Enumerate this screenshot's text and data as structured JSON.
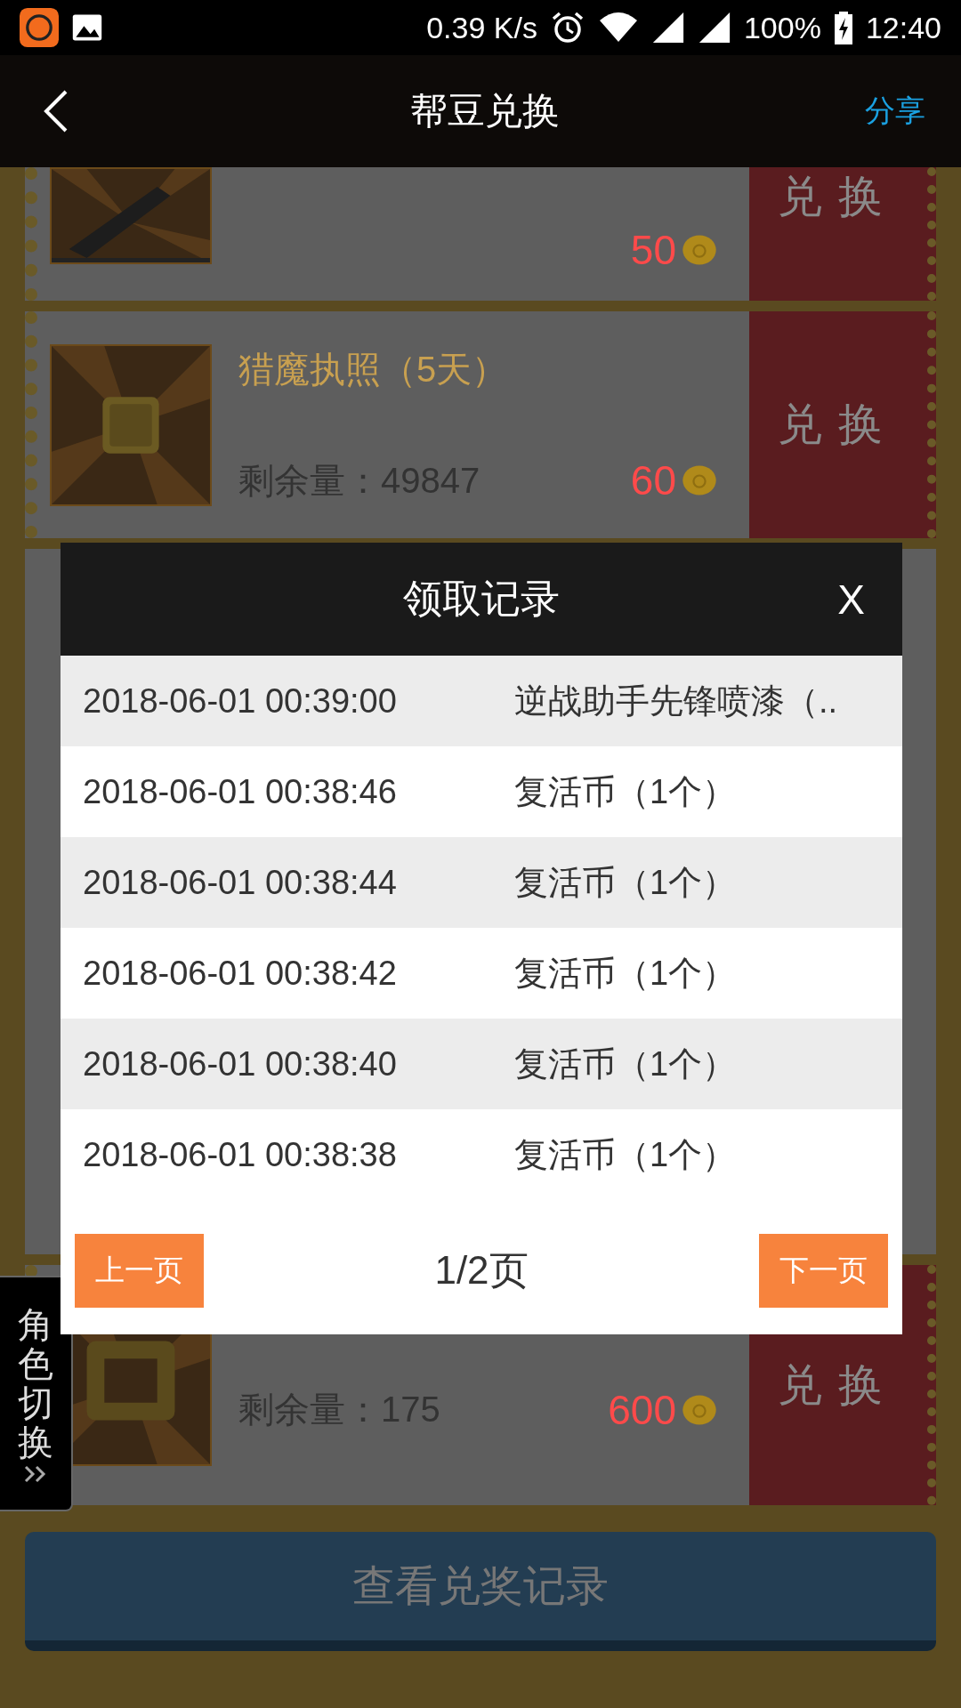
{
  "status_bar": {
    "net_speed": "0.39 K/s",
    "battery": "100%",
    "time": "12:40"
  },
  "header": {
    "title": "帮豆兑换",
    "action": "分享"
  },
  "items": [
    {
      "price": "50",
      "button": "兑换"
    },
    {
      "name": "猎魔执照（5天）",
      "stock": "剩余量：49847",
      "price": "60",
      "button": "兑换"
    },
    {
      "stock": "剩余量：175",
      "price": "600",
      "button": "兑换"
    }
  ],
  "side_tab": {
    "label": "角色切换"
  },
  "records_button": "查看兑奖记录",
  "dialog": {
    "title": "领取记录",
    "close": "X",
    "rows": [
      {
        "time": "2018-06-01 00:39:00",
        "item": "逆战助手先锋喷漆（.."
      },
      {
        "time": "2018-06-01 00:38:46",
        "item": "复活币（1个）"
      },
      {
        "time": "2018-06-01 00:38:44",
        "item": "复活币（1个）"
      },
      {
        "time": "2018-06-01 00:38:42",
        "item": "复活币（1个）"
      },
      {
        "time": "2018-06-01 00:38:40",
        "item": "复活币（1个）"
      },
      {
        "time": "2018-06-01 00:38:38",
        "item": "复活币（1个）"
      }
    ],
    "prev": "上一页",
    "page": "1/2页",
    "next": "下一页"
  }
}
